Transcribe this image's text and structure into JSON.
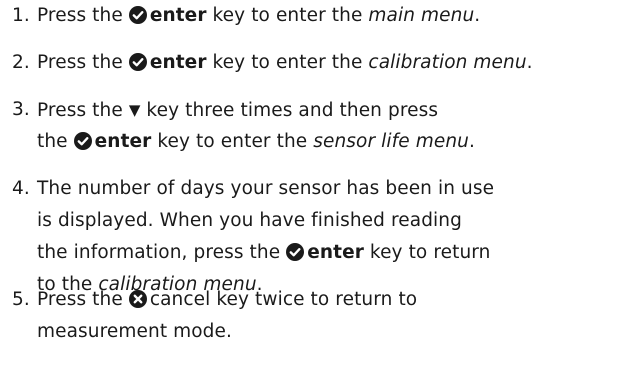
{
  "steps": [
    {
      "number": "1.",
      "lines": [
        {
          "pre": "Press the ",
          "key": "enter",
          "mid": " key to enter the ",
          "em": "main menu",
          "post": "."
        }
      ]
    },
    {
      "number": "2.",
      "lines": [
        {
          "pre": "Press the ",
          "key": "enter",
          "mid": " key to enter the ",
          "em": "calibration menu",
          "post": "."
        }
      ]
    },
    {
      "number": "3.",
      "lines": [
        {
          "pre": "Press the ",
          "arrow": "▼",
          "mid": " key three times and then press"
        },
        {
          "pre": "the ",
          "key": "enter",
          "mid": " key to enter the ",
          "em": "sensor life menu",
          "post": "."
        }
      ]
    },
    {
      "number": "4.",
      "lines": [
        {
          "text": "The number of days your sensor has been in use"
        },
        {
          "text": "is displayed. When you have finished reading"
        },
        {
          "pre": "the information, press the ",
          "key": "enter",
          "mid": " key to return"
        },
        {
          "pre": "to the ",
          "em": "calibration menu",
          "post": "."
        }
      ]
    },
    {
      "number": "5.",
      "lines": [
        {
          "pre": "Press the ",
          "cancel_word": "cancel",
          "mid": " key twice to return to"
        },
        {
          "text": "measurement mode."
        }
      ]
    }
  ],
  "icons": {
    "enter": "check-circle-icon",
    "cancel": "x-circle-icon",
    "arrow": "down-triangle-icon"
  }
}
